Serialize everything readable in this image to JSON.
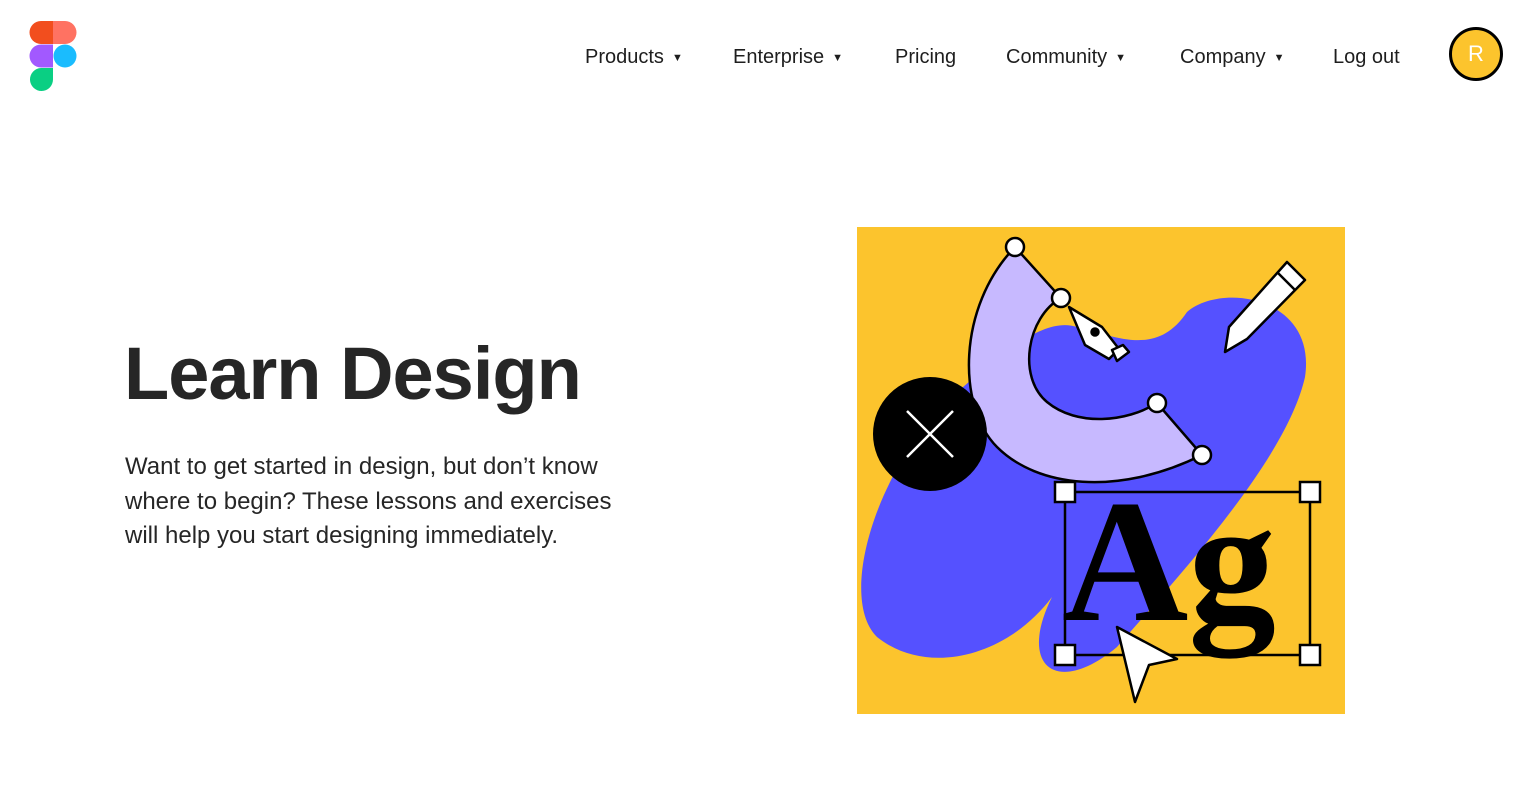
{
  "header": {
    "logo": "figma-logo",
    "nav": [
      {
        "label": "Products",
        "caret": "▼",
        "has_dropdown": true
      },
      {
        "label": "Enterprise",
        "caret": "▼",
        "has_dropdown": true
      },
      {
        "label": "Pricing",
        "has_dropdown": false
      },
      {
        "label": "Community",
        "caret": "▼",
        "has_dropdown": true
      },
      {
        "label": "Company",
        "caret": "▼",
        "has_dropdown": true
      },
      {
        "label": "Log out",
        "has_dropdown": false
      }
    ],
    "avatar": {
      "initial": "R",
      "color": "#fcc42d"
    }
  },
  "hero": {
    "title": "Learn Design",
    "description": "Want to get started in design, but don’t know where to begin? These lessons and exercises will help you start designing immediately.",
    "illustration": {
      "text": "Ag",
      "colors": {
        "background": "#fcc42d",
        "blue": "#5551ff",
        "lavender": "#c7b9ff",
        "black": "#000000",
        "white": "#ffffff"
      }
    }
  },
  "brand_colors": {
    "red": "#f24e1e",
    "coral": "#ff7262",
    "purple": "#a259ff",
    "blue": "#1abcfe",
    "green": "#0acf83"
  }
}
